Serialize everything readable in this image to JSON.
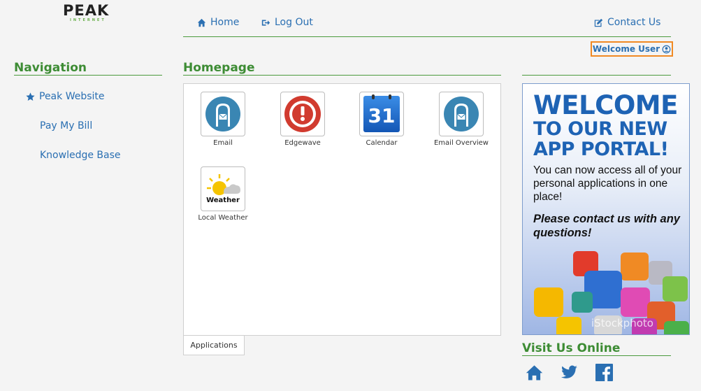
{
  "brand": {
    "name": "PEAK",
    "sub": "INTERNET"
  },
  "topnav": {
    "home": "Home",
    "logout": "Log Out",
    "contact": "Contact Us"
  },
  "user": {
    "welcome": "Welcome User"
  },
  "navigation": {
    "title": "Navigation",
    "items": [
      {
        "label": "Peak Website",
        "icon": "star-icon"
      },
      {
        "label": "Pay My Bill"
      },
      {
        "label": "Knowledge Base"
      }
    ]
  },
  "homepage": {
    "title": "Homepage",
    "apps": [
      {
        "label": "Email",
        "icon": "mailbox-icon"
      },
      {
        "label": "Edgewave",
        "icon": "alert-icon"
      },
      {
        "label": "Calendar",
        "icon": "calendar-icon",
        "day": "31"
      },
      {
        "label": "Email Overview",
        "icon": "mailbox-icon"
      },
      {
        "label": "Local Weather",
        "icon": "weather-icon",
        "badge": "Weather"
      }
    ],
    "tab": "Applications"
  },
  "promo": {
    "line1": "WELCOME",
    "line2": "TO OUR NEW",
    "line3": "APP PORTAL!",
    "body": "You can now access all of your personal applications in one place!",
    "emphasis": "Please contact us with any questions!",
    "watermark": "iStockphoto"
  },
  "visit": {
    "title": "Visit Us Online",
    "links": [
      "home-icon",
      "twitter-icon",
      "facebook-icon"
    ]
  },
  "colors": {
    "accent": "#2a6fb2",
    "green": "#3d8c34",
    "highlight": "#f08a24"
  }
}
